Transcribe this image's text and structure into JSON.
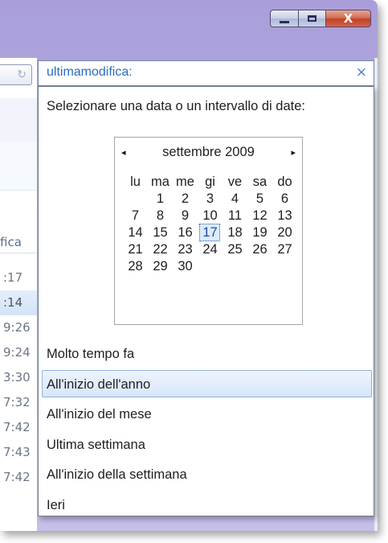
{
  "search": {
    "value": "ultimamodifica:",
    "clear_glyph": "×"
  },
  "nav": {
    "back_glyph": "↻"
  },
  "left_column": {
    "header": "fica",
    "times": [
      ":17",
      ":14",
      "9:26",
      "9:24",
      "3:30",
      "7:32",
      "7:42",
      "7:43",
      "7:42"
    ]
  },
  "dropdown": {
    "prompt": "Selezionare una data o un intervallo di date:",
    "calendar": {
      "month_label": "settembre 2009",
      "prev_glyph": "◂",
      "next_glyph": "▸",
      "weekdays": [
        "lu",
        "ma",
        "me",
        "gi",
        "ve",
        "sa",
        "do"
      ],
      "weeks": [
        [
          "",
          "1",
          "2",
          "3",
          "4",
          "5",
          "6"
        ],
        [
          "7",
          "8",
          "9",
          "10",
          "11",
          "12",
          "13"
        ],
        [
          "14",
          "15",
          "16",
          "17",
          "18",
          "19",
          "20"
        ],
        [
          "21",
          "22",
          "23",
          "24",
          "25",
          "26",
          "27"
        ],
        [
          "28",
          "29",
          "30",
          "",
          "",
          "",
          ""
        ]
      ],
      "today": "17"
    },
    "options": [
      "Molto tempo fa",
      "All'inizio dell'anno",
      "All'inizio del mese",
      "Ultima settimana",
      "All'inizio della settimana",
      "Ieri"
    ],
    "hovered_option": "All'inizio dell'anno"
  },
  "colors": {
    "accent": "#2b6cc1",
    "highlight": "#d7e6fa",
    "close_button": "#c34128"
  }
}
